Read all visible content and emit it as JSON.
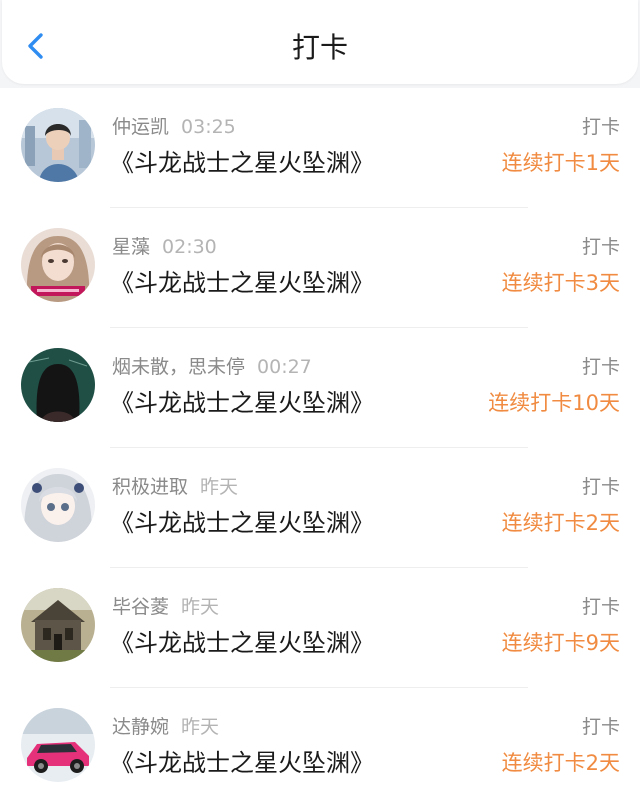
{
  "header": {
    "title": "打卡",
    "back_icon": "chevron-left-icon",
    "accent_color": "#2f8df2"
  },
  "colors": {
    "streak": "#f08b41",
    "name": "#8a8a8a",
    "time": "#b4b4b4",
    "book": "#1a1a1a"
  },
  "entries": [
    {
      "name": "仲运凯",
      "time": "03:25",
      "book": "《斗龙战士之星火坠渊》",
      "tag": "打卡",
      "streak": "连续打卡1天"
    },
    {
      "name": "星藻",
      "time": "02:30",
      "book": "《斗龙战士之星火坠渊》",
      "tag": "打卡",
      "streak": "连续打卡3天"
    },
    {
      "name": "烟未散，思未停",
      "time": "00:27",
      "book": "《斗龙战士之星火坠渊》",
      "tag": "打卡",
      "streak": "连续打卡10天"
    },
    {
      "name": "积极进取",
      "time": "昨天",
      "book": "《斗龙战士之星火坠渊》",
      "tag": "打卡",
      "streak": "连续打卡2天"
    },
    {
      "name": "毕谷菱",
      "time": "昨天",
      "book": "《斗龙战士之星火坠渊》",
      "tag": "打卡",
      "streak": "连续打卡9天"
    },
    {
      "name": "达静婉",
      "time": "昨天",
      "book": "《斗龙战士之星火坠渊》",
      "tag": "打卡",
      "streak": "连续打卡2天"
    }
  ]
}
